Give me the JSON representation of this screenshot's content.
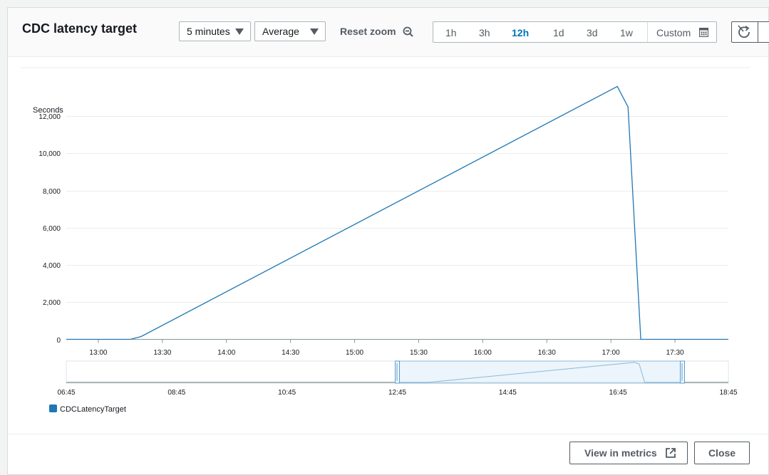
{
  "header": {
    "title": "CDC latency target",
    "period_select": "5 minutes",
    "stat_select": "Average",
    "reset_zoom": "Reset zoom",
    "ranges": [
      "1h",
      "3h",
      "12h",
      "1d",
      "3d",
      "1w"
    ],
    "active_range": "12h",
    "custom": "Custom"
  },
  "footer": {
    "view_metrics": "View in metrics",
    "close": "Close"
  },
  "colors": {
    "series": "#1f77b4",
    "accent": "#0073bb"
  },
  "chart_data": {
    "type": "line",
    "ylabel": "Seconds",
    "xlabel": "",
    "ylim": [
      0,
      14000
    ],
    "yticks": [
      0,
      2000,
      4000,
      6000,
      8000,
      10000,
      12000
    ],
    "ytick_labels": [
      "0",
      "2,000",
      "4,000",
      "6,000",
      "8,000",
      "10,000",
      "12,000"
    ],
    "xlim": [
      "12:45",
      "17:55"
    ],
    "xticks": [
      "13:00",
      "13:30",
      "14:00",
      "14:30",
      "15:00",
      "15:30",
      "16:00",
      "16:30",
      "17:00",
      "17:30"
    ],
    "grid": "horizontal",
    "legend_position": "bottom-left",
    "series": [
      {
        "name": "CDCLatencyTarget",
        "color": "#1f77b4",
        "points": [
          {
            "x": "12:45",
            "y": 0
          },
          {
            "x": "13:15",
            "y": 0
          },
          {
            "x": "13:20",
            "y": 150
          },
          {
            "x": "17:03",
            "y": 13600
          },
          {
            "x": "17:08",
            "y": 12500
          },
          {
            "x": "17:14",
            "y": 0
          },
          {
            "x": "17:55",
            "y": 0
          }
        ]
      }
    ],
    "navigator": {
      "xticks": [
        "06:45",
        "08:45",
        "10:45",
        "12:45",
        "14:45",
        "16:45",
        "18:45"
      ],
      "xlim": [
        "06:45",
        "18:45"
      ],
      "selection": [
        "12:45",
        "17:55"
      ]
    }
  }
}
